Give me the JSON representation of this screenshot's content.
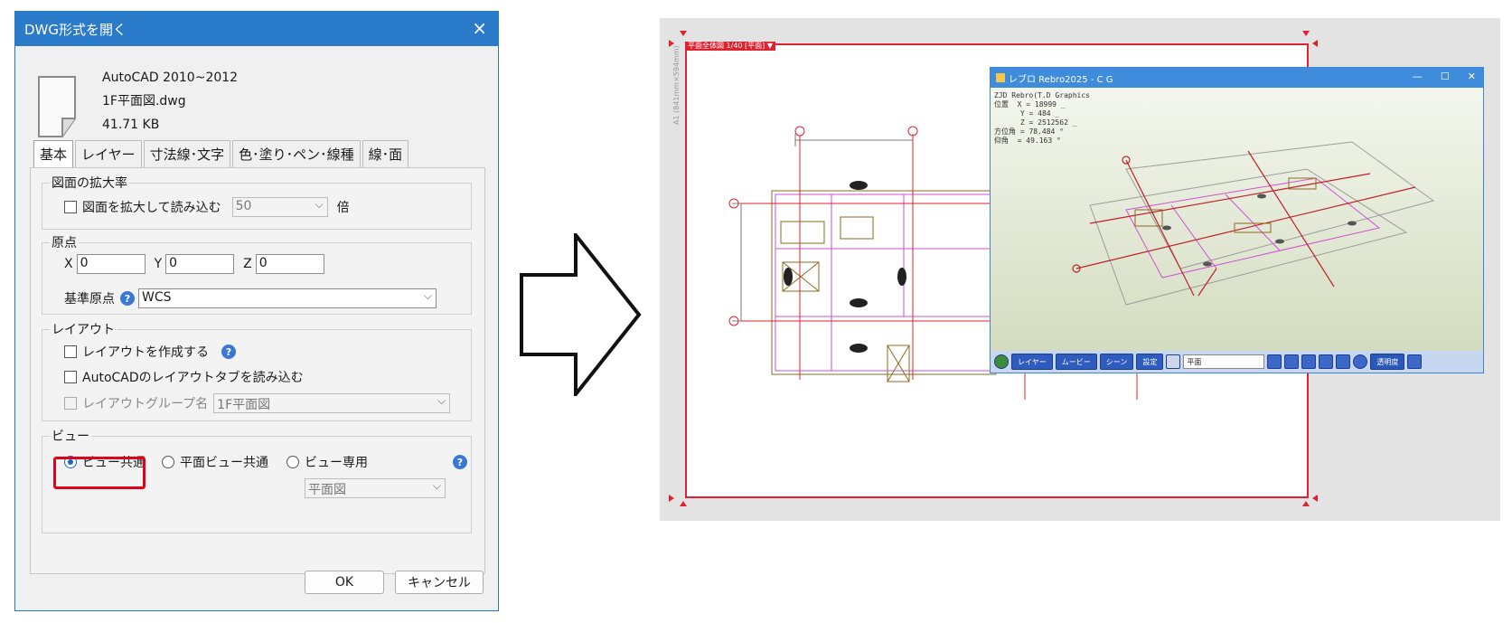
{
  "dialog": {
    "title": "DWG形式を開く",
    "close_label": "×",
    "file": {
      "format": "AutoCAD 2010~2012",
      "name": "1F平面図.dwg",
      "size": "41.71 KB"
    },
    "tabs": [
      "基本",
      "レイヤー",
      "寸法線･文字",
      "色･塗り･ペン･線種",
      "線･面"
    ],
    "scale_group": {
      "title": "図面の拡大率",
      "checkbox_label": "図面を拡大して読み込む",
      "value": "50",
      "unit": "倍"
    },
    "origin_group": {
      "title": "原点",
      "x_label": "X",
      "x_value": "0",
      "y_label": "Y",
      "y_value": "0",
      "z_label": "Z",
      "z_value": "0",
      "base_label": "基準原点",
      "base_value": "WCS"
    },
    "layout_group": {
      "title": "レイアウト",
      "create_label": "レイアウトを作成する",
      "read_tabs_label": "AutoCADのレイアウトタブを読み込む",
      "group_name_label": "レイアウトグループ名",
      "group_name_value": "1F平面図"
    },
    "view_group": {
      "title": "ビュー",
      "option_common": "ビュー共通",
      "option_plan_common": "平面ビュー共通",
      "option_dedicated": "ビュー専用",
      "dedicated_value": "平面図"
    },
    "ok_label": "OK",
    "cancel_label": "キャンセル"
  },
  "help_glyph": "?",
  "canvas": {
    "sheet_tag": "平面全体図 1/40 [平面] ▼",
    "side_label": "A1 (841mm×594mm)"
  },
  "cg_window": {
    "title": "レブロ Rebro2025 - C G",
    "controls": [
      "—",
      "☐",
      "✕"
    ],
    "info_lines": [
      "ZJD Rebro(T.D Graphics",
      "位置  X = 18999 _",
      "      Y = 484 _",
      "      Z = 2512562 _",
      "方位角 = 78.484 °",
      "仰角  = 49.163 °"
    ],
    "toolbar": {
      "layer": "レイヤー",
      "movie": "ムービー",
      "scene": "シーン",
      "settings": "設定",
      "view_select": "平面",
      "transparency": "透明度"
    }
  },
  "colors": {
    "title_bar": "#2b7bcb",
    "highlight": "#e3001b",
    "paper_border": "#e0212f",
    "plan_magenta": "#d050d0",
    "plan_olive": "#8a6a20"
  }
}
